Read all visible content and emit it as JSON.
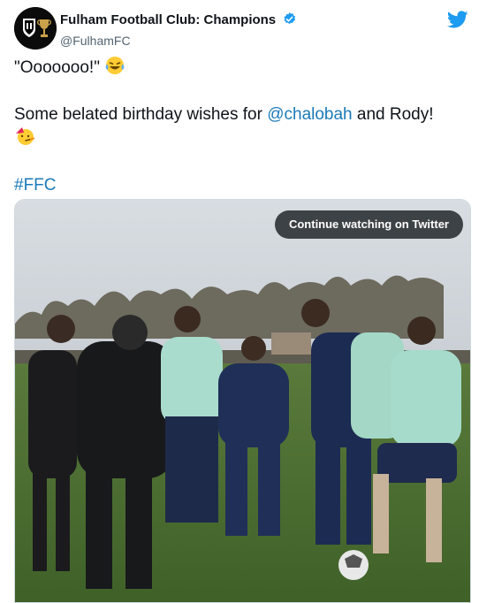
{
  "author": {
    "display_name": "Fulham Football Club: Champions",
    "handle": "@FulhamFC",
    "avatar_icon": "fulham-crest-icon",
    "verified_icon": "verified-badge-icon"
  },
  "tweet": {
    "line1_text": "\"Ooooooo!\"",
    "line1_emoji": "tears-of-joy-emoji",
    "line2_prefix": "Some belated birthday wishes for ",
    "line2_mention": "@chalobah",
    "line2_suffix": " and Rody!",
    "line2_emoji": "party-face-emoji",
    "hashtag": "#FFC"
  },
  "media": {
    "continue_label": "Continue watching on Twitter"
  },
  "colors": {
    "link": "#1b7ab8",
    "twitter_blue": "#1d9bf0",
    "pitch_green": "#4a6e33"
  },
  "icons": {
    "brand": "twitter-bird-icon"
  }
}
